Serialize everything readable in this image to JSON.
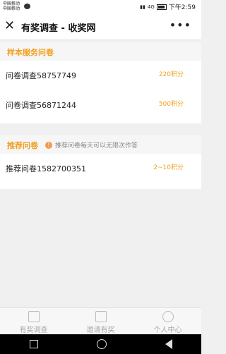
{
  "statusbar": {
    "carrier1": "中国移动",
    "carrier2": "中国移动",
    "network": "4G",
    "time": "下午2:59"
  },
  "header": {
    "title": "有奖调查 - 收奖网"
  },
  "sample_section": {
    "title": "样本服务问卷",
    "items": [
      {
        "name": "问卷调查58757749",
        "points": "220积分"
      },
      {
        "name": "问卷调查56871244",
        "points": "500积分"
      }
    ]
  },
  "recommend_section": {
    "title": "推荐问卷",
    "tip": "推荐问卷每天可以无限次作答",
    "items": [
      {
        "name": "推荐问卷1582700351",
        "points": "2~10积分"
      }
    ]
  },
  "tabbar": {
    "tabs": [
      {
        "label": "有奖调查"
      },
      {
        "label": "邀请有奖"
      },
      {
        "label": "个人中心"
      }
    ]
  }
}
